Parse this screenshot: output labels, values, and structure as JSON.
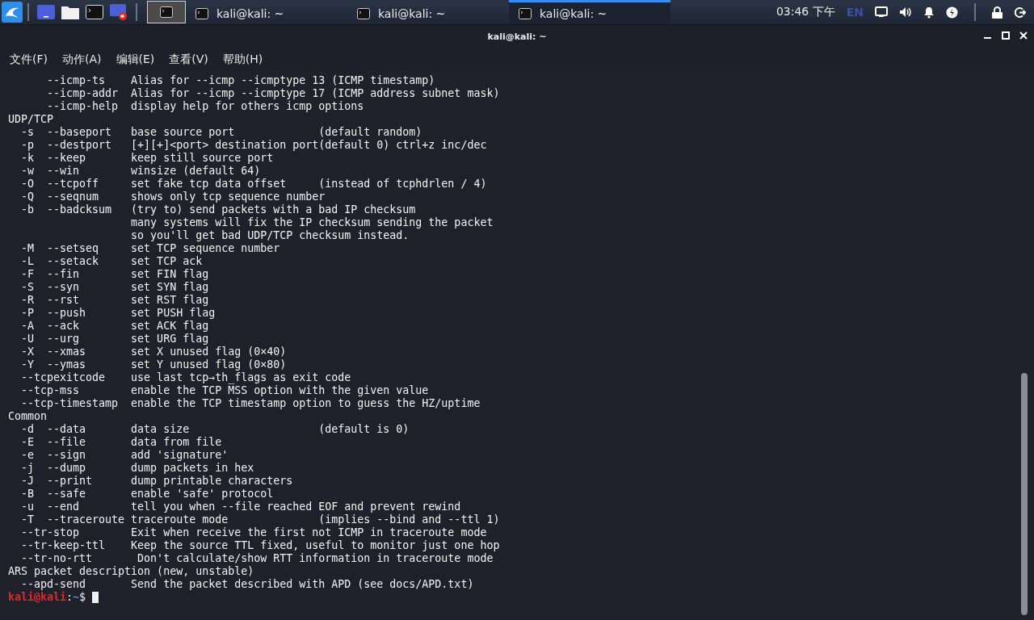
{
  "taskbar": {
    "workspace": {
      "selected": true
    },
    "tasks": [
      {
        "title": "kali@kali: ~",
        "selected": false
      },
      {
        "title": "kali@kali: ~",
        "selected": false
      },
      {
        "title": "kali@kali: ~",
        "selected": true
      }
    ],
    "clock": "03:46 下午",
    "keyboard_layout": "EN"
  },
  "window": {
    "title": "kali@kali: ~"
  },
  "menu": [
    "文件(F)",
    "动作(A)",
    "编辑(E)",
    "查看(V)",
    "帮助(H)"
  ],
  "terminal": {
    "lines": [
      "      --icmp-ts    Alias for --icmp --icmptype 13 (ICMP timestamp)",
      "      --icmp-addr  Alias for --icmp --icmptype 17 (ICMP address subnet mask)",
      "      --icmp-help  display help for others icmp options",
      "UDP/TCP",
      "  -s  --baseport   base source port             (default random)",
      "  -p  --destport   [+][+]<port> destination port(default 0) ctrl+z inc/dec",
      "  -k  --keep       keep still source port",
      "  -w  --win        winsize (default 64)",
      "  -O  --tcpoff     set fake tcp data offset     (instead of tcphdrlen / 4)",
      "  -Q  --seqnum     shows only tcp sequence number",
      "  -b  --badcksum   (try to) send packets with a bad IP checksum",
      "                   many systems will fix the IP checksum sending the packet",
      "                   so you'll get bad UDP/TCP checksum instead.",
      "  -M  --setseq     set TCP sequence number",
      "  -L  --setack     set TCP ack",
      "  -F  --fin        set FIN flag",
      "  -S  --syn        set SYN flag",
      "  -R  --rst        set RST flag",
      "  -P  --push       set PUSH flag",
      "  -A  --ack        set ACK flag",
      "  -U  --urg        set URG flag",
      "  -X  --xmas       set X unused flag (0×40)",
      "  -Y  --ymas       set Y unused flag (0×80)",
      "  --tcpexitcode    use last tcp→th_flags as exit code",
      "  --tcp-mss        enable the TCP MSS option with the given value",
      "  --tcp-timestamp  enable the TCP timestamp option to guess the HZ/uptime",
      "Common",
      "  -d  --data       data size                    (default is 0)",
      "  -E  --file       data from file",
      "  -e  --sign       add 'signature'",
      "  -j  --dump       dump packets in hex",
      "  -J  --print      dump printable characters",
      "  -B  --safe       enable 'safe' protocol",
      "  -u  --end        tell you when --file reached EOF and prevent rewind",
      "  -T  --traceroute traceroute mode              (implies --bind and --ttl 1)",
      "  --tr-stop        Exit when receive the first not ICMP in traceroute mode",
      "  --tr-keep-ttl    Keep the source TTL fixed, useful to monitor just one hop",
      "  --tr-no-rtt       Don't calculate/show RTT information in traceroute mode",
      "ARS packet description (new, unstable)",
      "  --apd-send       Send the packet described with APD (see docs/APD.txt)"
    ],
    "prompt": {
      "user": "kali@kali",
      "separator": ":",
      "path": "~",
      "symbol": "$"
    }
  }
}
